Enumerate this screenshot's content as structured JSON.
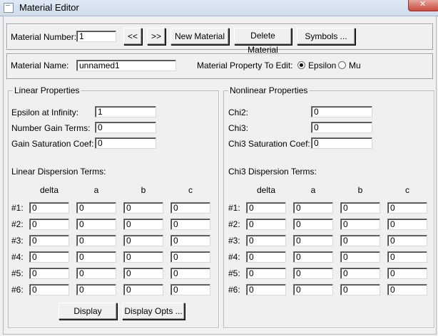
{
  "window": {
    "title": "Material Editor"
  },
  "toolbar": {
    "material_number_label": "Material Number:",
    "material_number_value": "1",
    "prev_label": "<<",
    "next_label": ">>",
    "new_material_label": "New Material",
    "delete_material_label": "Delete Material",
    "symbols_label": "Symbols ..."
  },
  "name_row": {
    "material_name_label": "Material Name:",
    "material_name_value": "unnamed1",
    "property_label": "Material Property To Edit:",
    "option_epsilon": "Epsilon",
    "option_mu": "Mu",
    "selected": "Epsilon"
  },
  "linear": {
    "title": "Linear Properties",
    "eps_inf_label": "Epsilon at Infinity:",
    "eps_inf_value": "1",
    "gain_terms_label": "Number Gain Terms:",
    "gain_terms_value": "0",
    "gain_sat_label": "Gain Saturation Coef:",
    "gain_sat_value": "0",
    "dispersion_label": "Linear Dispersion Terms:",
    "columns": [
      "delta",
      "a",
      "b",
      "c"
    ],
    "row_labels": [
      "#1:",
      "#2:",
      "#3:",
      "#4:",
      "#5:",
      "#6:"
    ],
    "values": [
      [
        "0",
        "0",
        "0",
        "0"
      ],
      [
        "0",
        "0",
        "0",
        "0"
      ],
      [
        "0",
        "0",
        "0",
        "0"
      ],
      [
        "0",
        "0",
        "0",
        "0"
      ],
      [
        "0",
        "0",
        "0",
        "0"
      ],
      [
        "0",
        "0",
        "0",
        "0"
      ]
    ],
    "display_label": "Display",
    "display_opts_label": "Display Opts ..."
  },
  "nonlinear": {
    "title": "Nonlinear Properties",
    "chi2_label": "Chi2:",
    "chi2_value": "0",
    "chi3_label": "Chi3:",
    "chi3_value": "0",
    "chi3_sat_label": "Chi3 Saturation Coef:",
    "chi3_sat_value": "0",
    "dispersion_label": "Chi3 Dispersion Terms:",
    "columns": [
      "delta",
      "a",
      "b",
      "c"
    ],
    "row_labels": [
      "#1:",
      "#2:",
      "#3:",
      "#4:",
      "#5:",
      "#6:"
    ],
    "values": [
      [
        "0",
        "0",
        "0",
        "0"
      ],
      [
        "0",
        "0",
        "0",
        "0"
      ],
      [
        "0",
        "0",
        "0",
        "0"
      ],
      [
        "0",
        "0",
        "0",
        "0"
      ],
      [
        "0",
        "0",
        "0",
        "0"
      ],
      [
        "0",
        "0",
        "0",
        "0"
      ]
    ]
  }
}
